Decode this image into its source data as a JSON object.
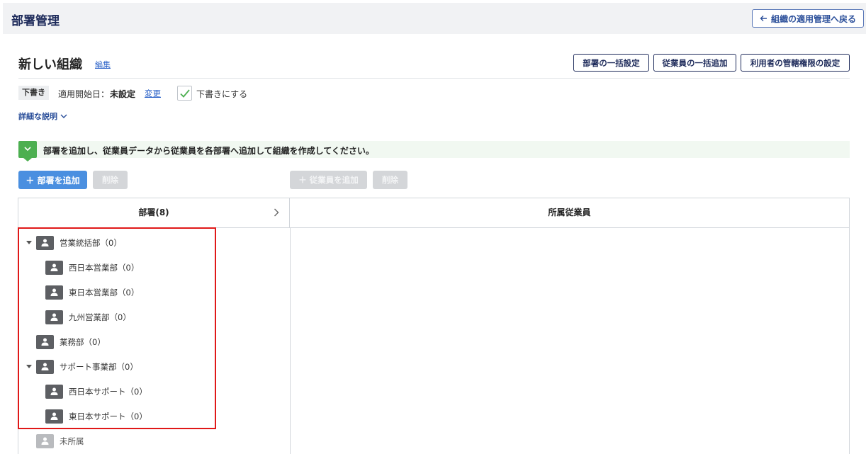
{
  "header": {
    "title": "部署管理",
    "back_button": "組織の適用管理へ戻る"
  },
  "org": {
    "name": "新しい組織",
    "edit_link": "編集",
    "actions": {
      "bulk_department": "部署の一括設定",
      "bulk_employee": "従業員の一括追加",
      "user_permission": "利用者の管轄権限の設定"
    },
    "status_badge": "下書き",
    "apply_date_label": "適用開始日：",
    "apply_date_value": "未設定",
    "change_link": "変更",
    "draft_checkbox_label": "下書きにする",
    "draft_checked": true,
    "details_toggle": "詳細な説明"
  },
  "banner": {
    "icon": "chevron-down-icon",
    "text": "部署を追加し、従業員データから従業員を各部署へ追加して組織を作成してください。",
    "color": "#4caf50"
  },
  "toolbar": {
    "add_department": "部署を追加",
    "delete_department": "削除",
    "add_employee": "従業員を追加",
    "delete_employee": "削除"
  },
  "departments_panel": {
    "header": "部署(8)",
    "items": [
      {
        "label": "営業統括部（0）",
        "level": 0,
        "expanded": true
      },
      {
        "label": "西日本営業部（0）",
        "level": 1
      },
      {
        "label": "東日本営業部（0）",
        "level": 1
      },
      {
        "label": "九州営業部（0）",
        "level": 1
      },
      {
        "label": "業務部（0）",
        "level": 0
      },
      {
        "label": "サポート事業部（0）",
        "level": 0,
        "expanded": true
      },
      {
        "label": "西日本サポート（0）",
        "level": 1
      },
      {
        "label": "東日本サポート（0）",
        "level": 1
      },
      {
        "label": "未所属",
        "level": 0,
        "muted": true
      }
    ]
  },
  "employees_panel": {
    "header": "所属従業員"
  },
  "colors": {
    "primary": "#4a8fe0",
    "navy": "#1d2a5a",
    "highlight": "#e01818"
  }
}
